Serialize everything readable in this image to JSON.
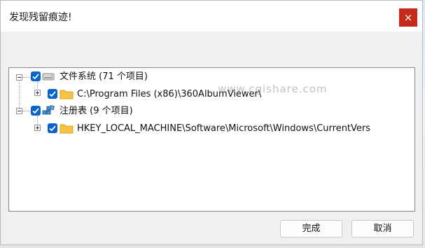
{
  "window": {
    "title": "发现残留痕迹!",
    "close_glyph": "×"
  },
  "tree": {
    "nodes": [
      {
        "label": "文件系统 (71 个项目)",
        "icon": "drive-icon",
        "checked": true,
        "expanded": true,
        "children": [
          {
            "label": "C:\\Program Files (x86)\\360AlbumViewer\\",
            "icon": "folder-icon",
            "checked": true,
            "expanded": false
          }
        ]
      },
      {
        "label": "注册表 (9 个项目)",
        "icon": "registry-icon",
        "checked": true,
        "expanded": true,
        "children": [
          {
            "label": "HKEY_LOCAL_MACHINE\\Software\\Microsoft\\Windows\\CurrentVers",
            "icon": "folder-icon",
            "checked": true,
            "expanded": false
          }
        ]
      }
    ]
  },
  "watermark": "www.cgishare.com",
  "buttons": {
    "ok": "完成",
    "cancel": "取消"
  },
  "colors": {
    "checkbox": "#0a64c8",
    "close_button": "#c42b1c",
    "folder": "#f6c343"
  }
}
